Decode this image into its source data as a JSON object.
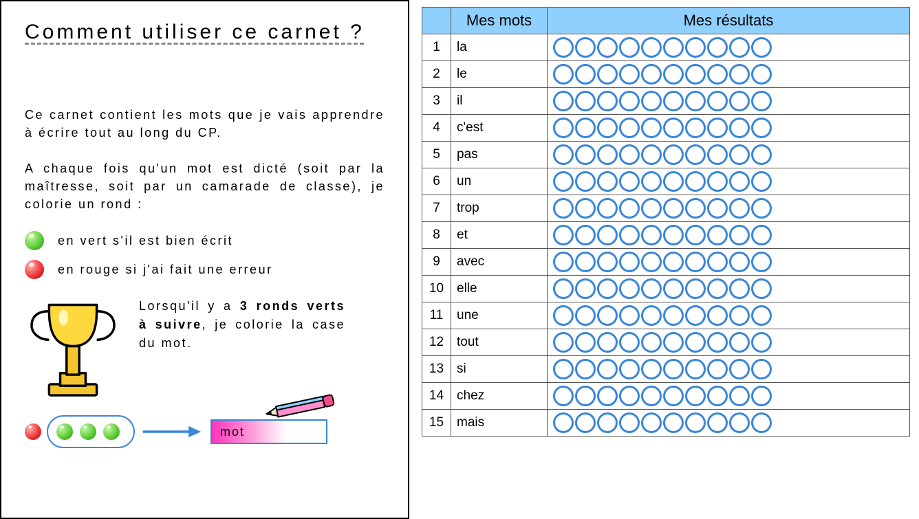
{
  "left": {
    "title": "Comment utiliser ce carnet ?",
    "paragraph1": "Ce carnet contient les mots que je vais apprendre à écrire tout au long du CP.",
    "paragraph2": "A chaque fois qu'un mot est dicté (soit par la maîtresse, soit par un camarade de classe), je colorie un rond :",
    "bullet_green": "en vert s'il est bien écrit",
    "bullet_red": "en rouge si j'ai fait une erreur",
    "trophy_text_pre": "Lorsqu'il y a ",
    "trophy_text_bold": "3 ronds verts à suivre",
    "trophy_text_post": ", je colorie la case du mot.",
    "mot_label": "mot"
  },
  "table": {
    "header_words": "Mes mots",
    "header_results": "Mes résultats",
    "circle_count": 10,
    "rows": [
      {
        "n": 1,
        "word": "la"
      },
      {
        "n": 2,
        "word": "le"
      },
      {
        "n": 3,
        "word": "il"
      },
      {
        "n": 4,
        "word": "c'est"
      },
      {
        "n": 5,
        "word": "pas"
      },
      {
        "n": 6,
        "word": "un"
      },
      {
        "n": 7,
        "word": "trop"
      },
      {
        "n": 8,
        "word": "et"
      },
      {
        "n": 9,
        "word": "avec"
      },
      {
        "n": 10,
        "word": "elle"
      },
      {
        "n": 11,
        "word": "une"
      },
      {
        "n": 12,
        "word": "tout"
      },
      {
        "n": 13,
        "word": "si"
      },
      {
        "n": 14,
        "word": "chez"
      },
      {
        "n": 15,
        "word": "mais"
      }
    ]
  }
}
